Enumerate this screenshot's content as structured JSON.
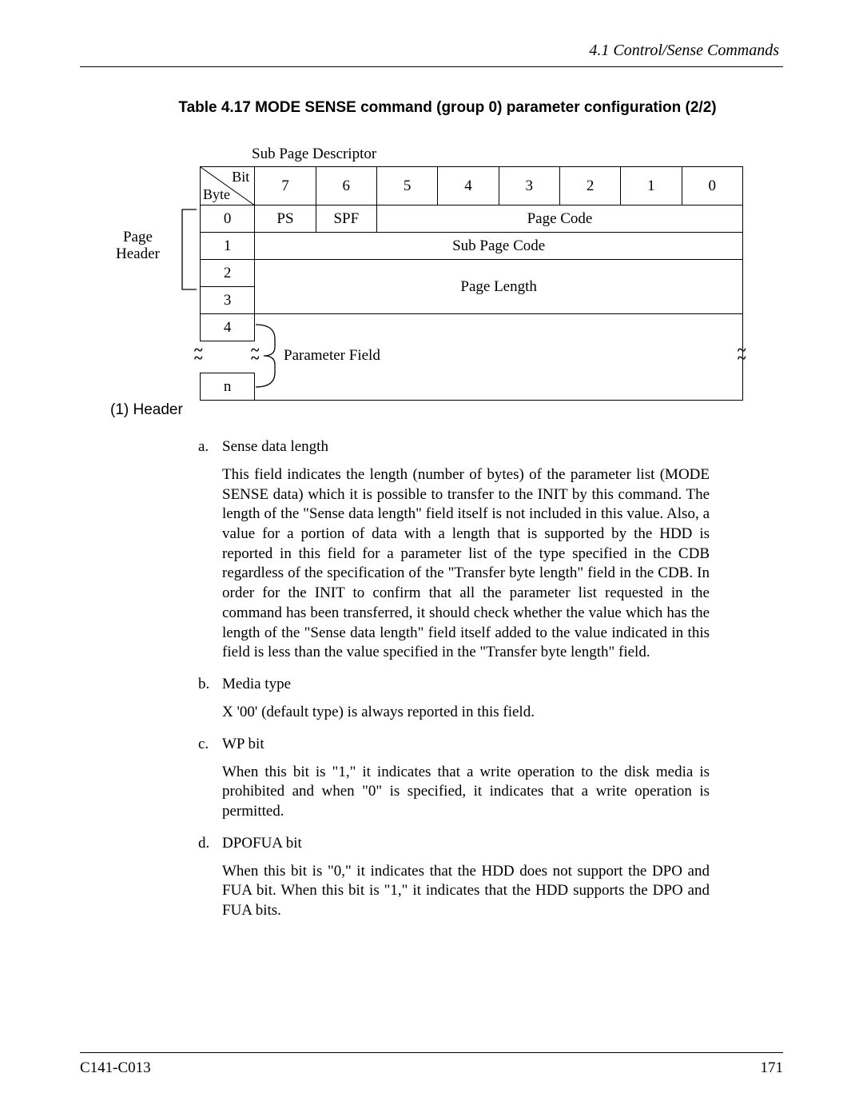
{
  "header": {
    "section": "4.1  Control/Sense Commands"
  },
  "caption": "Table 4.17  MODE SENSE command (group 0) parameter configuration (2/2)",
  "sub_label": "Sub Page Descriptor",
  "bits": {
    "b7": "7",
    "b6": "6",
    "b5": "5",
    "b4": "4",
    "b3": "3",
    "b2": "2",
    "b1": "1",
    "b0": "0"
  },
  "corner": {
    "bit": "Bit",
    "byte": "Byte"
  },
  "rows": {
    "r0": "0",
    "r1": "1",
    "r2": "2",
    "r3": "3",
    "r4": "4",
    "rn": "n"
  },
  "cells": {
    "ps": "PS",
    "spf": "SPF",
    "pagecode": "Page Code",
    "subpagecode": "Sub Page Code",
    "pagelength": "Page Length",
    "paramfield": "Parameter Field"
  },
  "bracket_label_l1": "Page",
  "bracket_label_l2": "Header",
  "section1": "(1)  Header",
  "items": [
    {
      "marker": "a.",
      "title": "Sense data length",
      "body": "This field indicates the length (number of bytes) of the parameter list (MODE SENSE data) which it is possible to transfer to the INIT by this command. The length of the \"Sense data length\" field itself is not included in this value. Also, a value for a portion of data with a length that is supported by the HDD is reported in this field for a parameter list of the type specified in the CDB regardless of the specification of the \"Transfer byte length\" field in the CDB. In order for the INIT to confirm that all the parameter list requested in the command has been transferred, it should check whether the value which has the length of the \"Sense data length\" field itself added to the value indicated in this field is less than the value specified in the \"Transfer byte length\" field."
    },
    {
      "marker": "b.",
      "title": "Media type",
      "body": "X '00' (default type) is always reported in this field."
    },
    {
      "marker": "c.",
      "title": "WP bit",
      "body": "When this bit is \"1,\"  it indicates that a write operation to the disk media is prohibited and when \"0\" is specified, it indicates that a write operation is permitted."
    },
    {
      "marker": "d.",
      "title": "DPOFUA bit",
      "body": "When this bit is \"0,\" it indicates that the HDD does not support the DPO and FUA bit.  When this bit is \"1,\" it indicates that the HDD supports the DPO and FUA bits."
    }
  ],
  "footer": {
    "doc": "C141-C013",
    "page": "171"
  }
}
